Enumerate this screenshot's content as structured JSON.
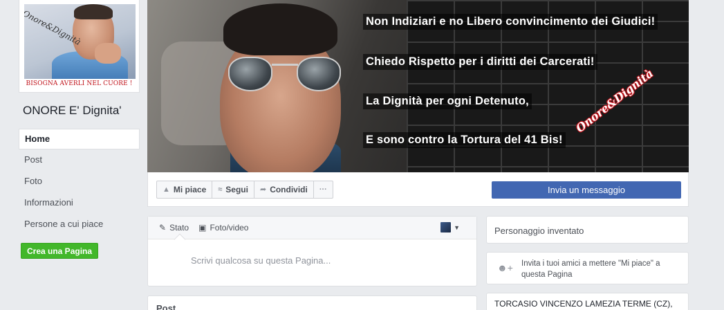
{
  "profile": {
    "watermark": "Onore&Dignità",
    "caption": "BISOGNA AVERLI NEL CUORE !"
  },
  "page_name": "ONORE E' Dignita'",
  "nav": {
    "items": [
      {
        "label": "Home"
      },
      {
        "label": "Post"
      },
      {
        "label": "Foto"
      },
      {
        "label": "Informazioni"
      },
      {
        "label": "Persone a cui piace"
      }
    ]
  },
  "create_page_label": "Crea una Pagina",
  "cover": {
    "lines": [
      "Non Indiziari e no Libero convincimento dei Giudici!",
      "Chiedo Rispetto per i diritti dei Carcerati!",
      "La Dignità per ogni Detenuto,",
      "E sono contro la Tortura del 41 Bis!"
    ],
    "watermark": "Onore&Dignità"
  },
  "actions": {
    "like": "Mi piace",
    "follow": "Segui",
    "share": "Condividi",
    "more": "···",
    "message": "Invia un messaggio"
  },
  "composer": {
    "tab_status": "Stato",
    "tab_photo": "Foto/video",
    "placeholder": "Scrivi qualcosa su questa Pagina..."
  },
  "posts_header": "Post",
  "sidebar": {
    "category": "Personaggio inventato",
    "invite": "Invita i tuoi amici a mettere \"Mi piace\" a questa Pagina",
    "about": "TORCASIO VINCENZO LAMEZIA TERME (CZ),"
  },
  "colors": {
    "brand_blue": "#4267b2",
    "green": "#42b72a",
    "background": "#e9ebee"
  }
}
